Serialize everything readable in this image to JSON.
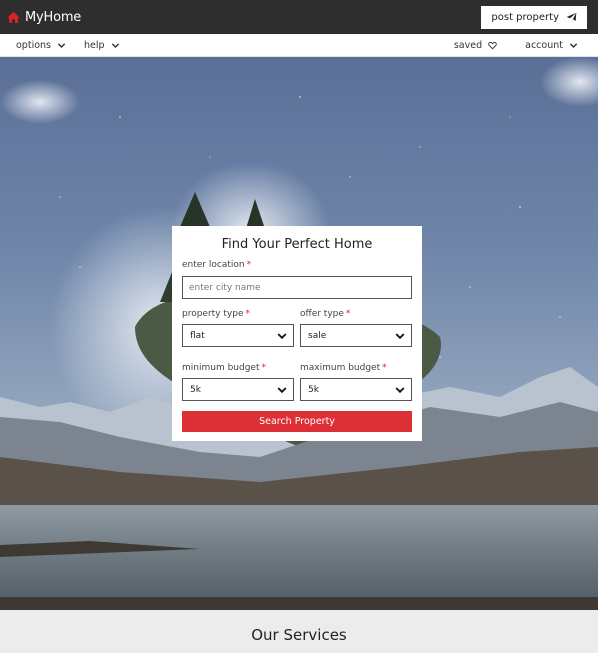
{
  "brand": {
    "name": "MyHome",
    "icon": "home-icon",
    "accent": "#e0202e"
  },
  "header": {
    "post_property_label": "post property",
    "post_property_icon": "paper-plane-icon"
  },
  "nav": {
    "left": [
      {
        "label": "options",
        "icon": "chevron-down-icon"
      },
      {
        "label": "help",
        "icon": "chevron-down-icon"
      }
    ],
    "right": [
      {
        "label": "saved",
        "icon": "heart-icon"
      },
      {
        "label": "account",
        "icon": "chevron-down-icon"
      }
    ]
  },
  "search": {
    "title": "Find Your Perfect Home",
    "location": {
      "label": "enter location",
      "placeholder": "enter city name",
      "required_mark": "*"
    },
    "property_type": {
      "label": "property type",
      "value": "flat",
      "required_mark": "*"
    },
    "offer_type": {
      "label": "offer type",
      "value": "sale",
      "required_mark": "*"
    },
    "min_budget": {
      "label": "minimum budget",
      "value": "5k",
      "required_mark": "*"
    },
    "max_budget": {
      "label": "maximum budget",
      "value": "5k",
      "required_mark": "*"
    },
    "submit_label": "Search Property",
    "button_color": "#dc2f36"
  },
  "services": {
    "title": "Our Services"
  }
}
